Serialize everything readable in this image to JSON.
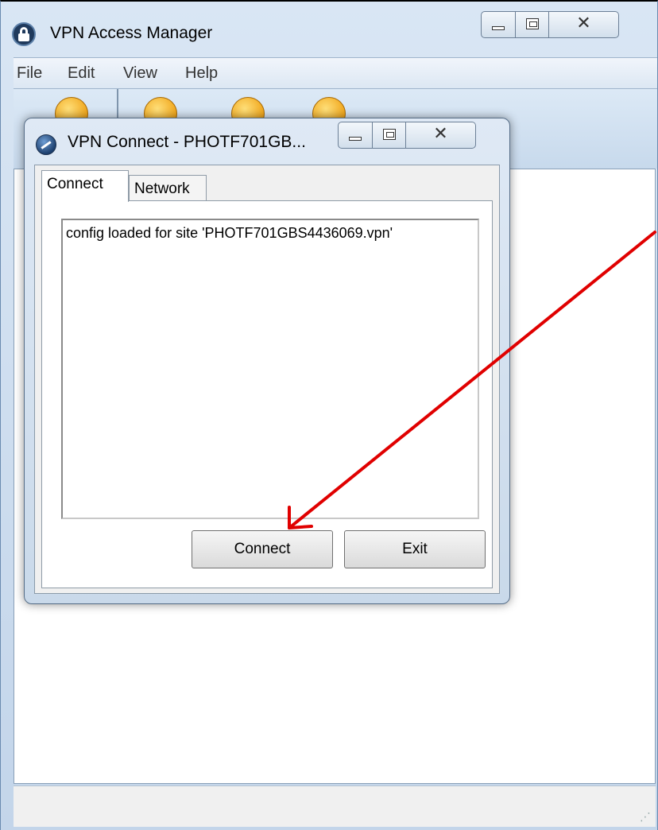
{
  "main_window": {
    "title": "VPN Access Manager",
    "menu": [
      {
        "label": "File"
      },
      {
        "label": "Edit"
      },
      {
        "label": "View"
      },
      {
        "label": "Help"
      }
    ],
    "controls": {
      "minimize": "minimize-icon",
      "maximize": "maximize-icon",
      "close": "close-icon"
    }
  },
  "dialog": {
    "title": "VPN Connect - PHOTF701GB...",
    "tabs": [
      {
        "label": "Connect",
        "active": true
      },
      {
        "label": "Network",
        "active": false
      }
    ],
    "log_lines": [
      "config loaded for site 'PHOTF701GBS4436069.vpn'"
    ],
    "buttons": {
      "connect": "Connect",
      "exit": "Exit"
    }
  },
  "colors": {
    "annotation_arrow": "#e00000",
    "toolbar_icon": "#f0a51a",
    "title_bar": "#c3d5ea"
  }
}
